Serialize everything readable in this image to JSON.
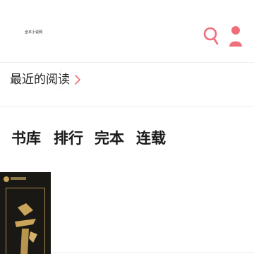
{
  "header": {
    "logo_text": "全本小说网",
    "search_icon": "search-icon",
    "user_icon": "user-icon",
    "accent_color": "#f06e7a"
  },
  "recent": {
    "label": "最近的阅读",
    "arrow_icon": "chevron-right-icon"
  },
  "tabs": [
    {
      "label": "书库"
    },
    {
      "label": "排行"
    },
    {
      "label": "完本"
    },
    {
      "label": "连载"
    }
  ],
  "book": {
    "cover_icon": "book-cover-image"
  }
}
